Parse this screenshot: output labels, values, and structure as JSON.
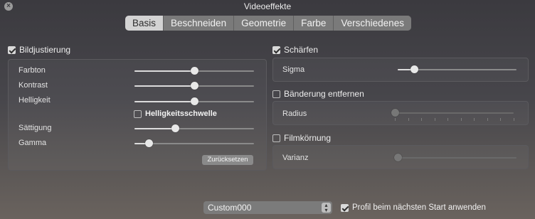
{
  "window": {
    "title": "Videoeffekte"
  },
  "tabs": [
    {
      "label": "Basis",
      "active": true
    },
    {
      "label": "Beschneiden",
      "active": false
    },
    {
      "label": "Geometrie",
      "active": false
    },
    {
      "label": "Farbe",
      "active": false
    },
    {
      "label": "Verschiedenes",
      "active": false
    }
  ],
  "image_adjust": {
    "label": "Bildjustierung",
    "enabled": true,
    "hue": {
      "label": "Farbton",
      "value": 0.5
    },
    "contrast": {
      "label": "Kontrast",
      "value": 0.5
    },
    "brightness": {
      "label": "Helligkeit",
      "value": 0.5
    },
    "brightness_threshold": {
      "label": "Helligkeitsschwelle",
      "checked": false
    },
    "saturation": {
      "label": "Sättigung",
      "value": 0.34
    },
    "gamma": {
      "label": "Gamma",
      "value": 0.12
    },
    "reset_label": "Zurücksetzen"
  },
  "sharpen": {
    "label": "Schärfen",
    "enabled": true,
    "sigma": {
      "label": "Sigma",
      "value": 0.14
    }
  },
  "debanding": {
    "label": "Bänderung entfernen",
    "enabled": false,
    "radius": {
      "label": "Radius",
      "value": 0.0
    }
  },
  "film_grain": {
    "label": "Filmkörnung",
    "enabled": false,
    "variance": {
      "label": "Varianz",
      "value": 0.0
    }
  },
  "profile": {
    "selected": "Custom000",
    "apply_on_start_label": "Profil beim nächsten Start anwenden",
    "apply_on_start_checked": true
  },
  "icons": {
    "close": "close-icon",
    "checkmark": "checkmark-icon",
    "select_arrows": "chevron-updown-icon"
  }
}
